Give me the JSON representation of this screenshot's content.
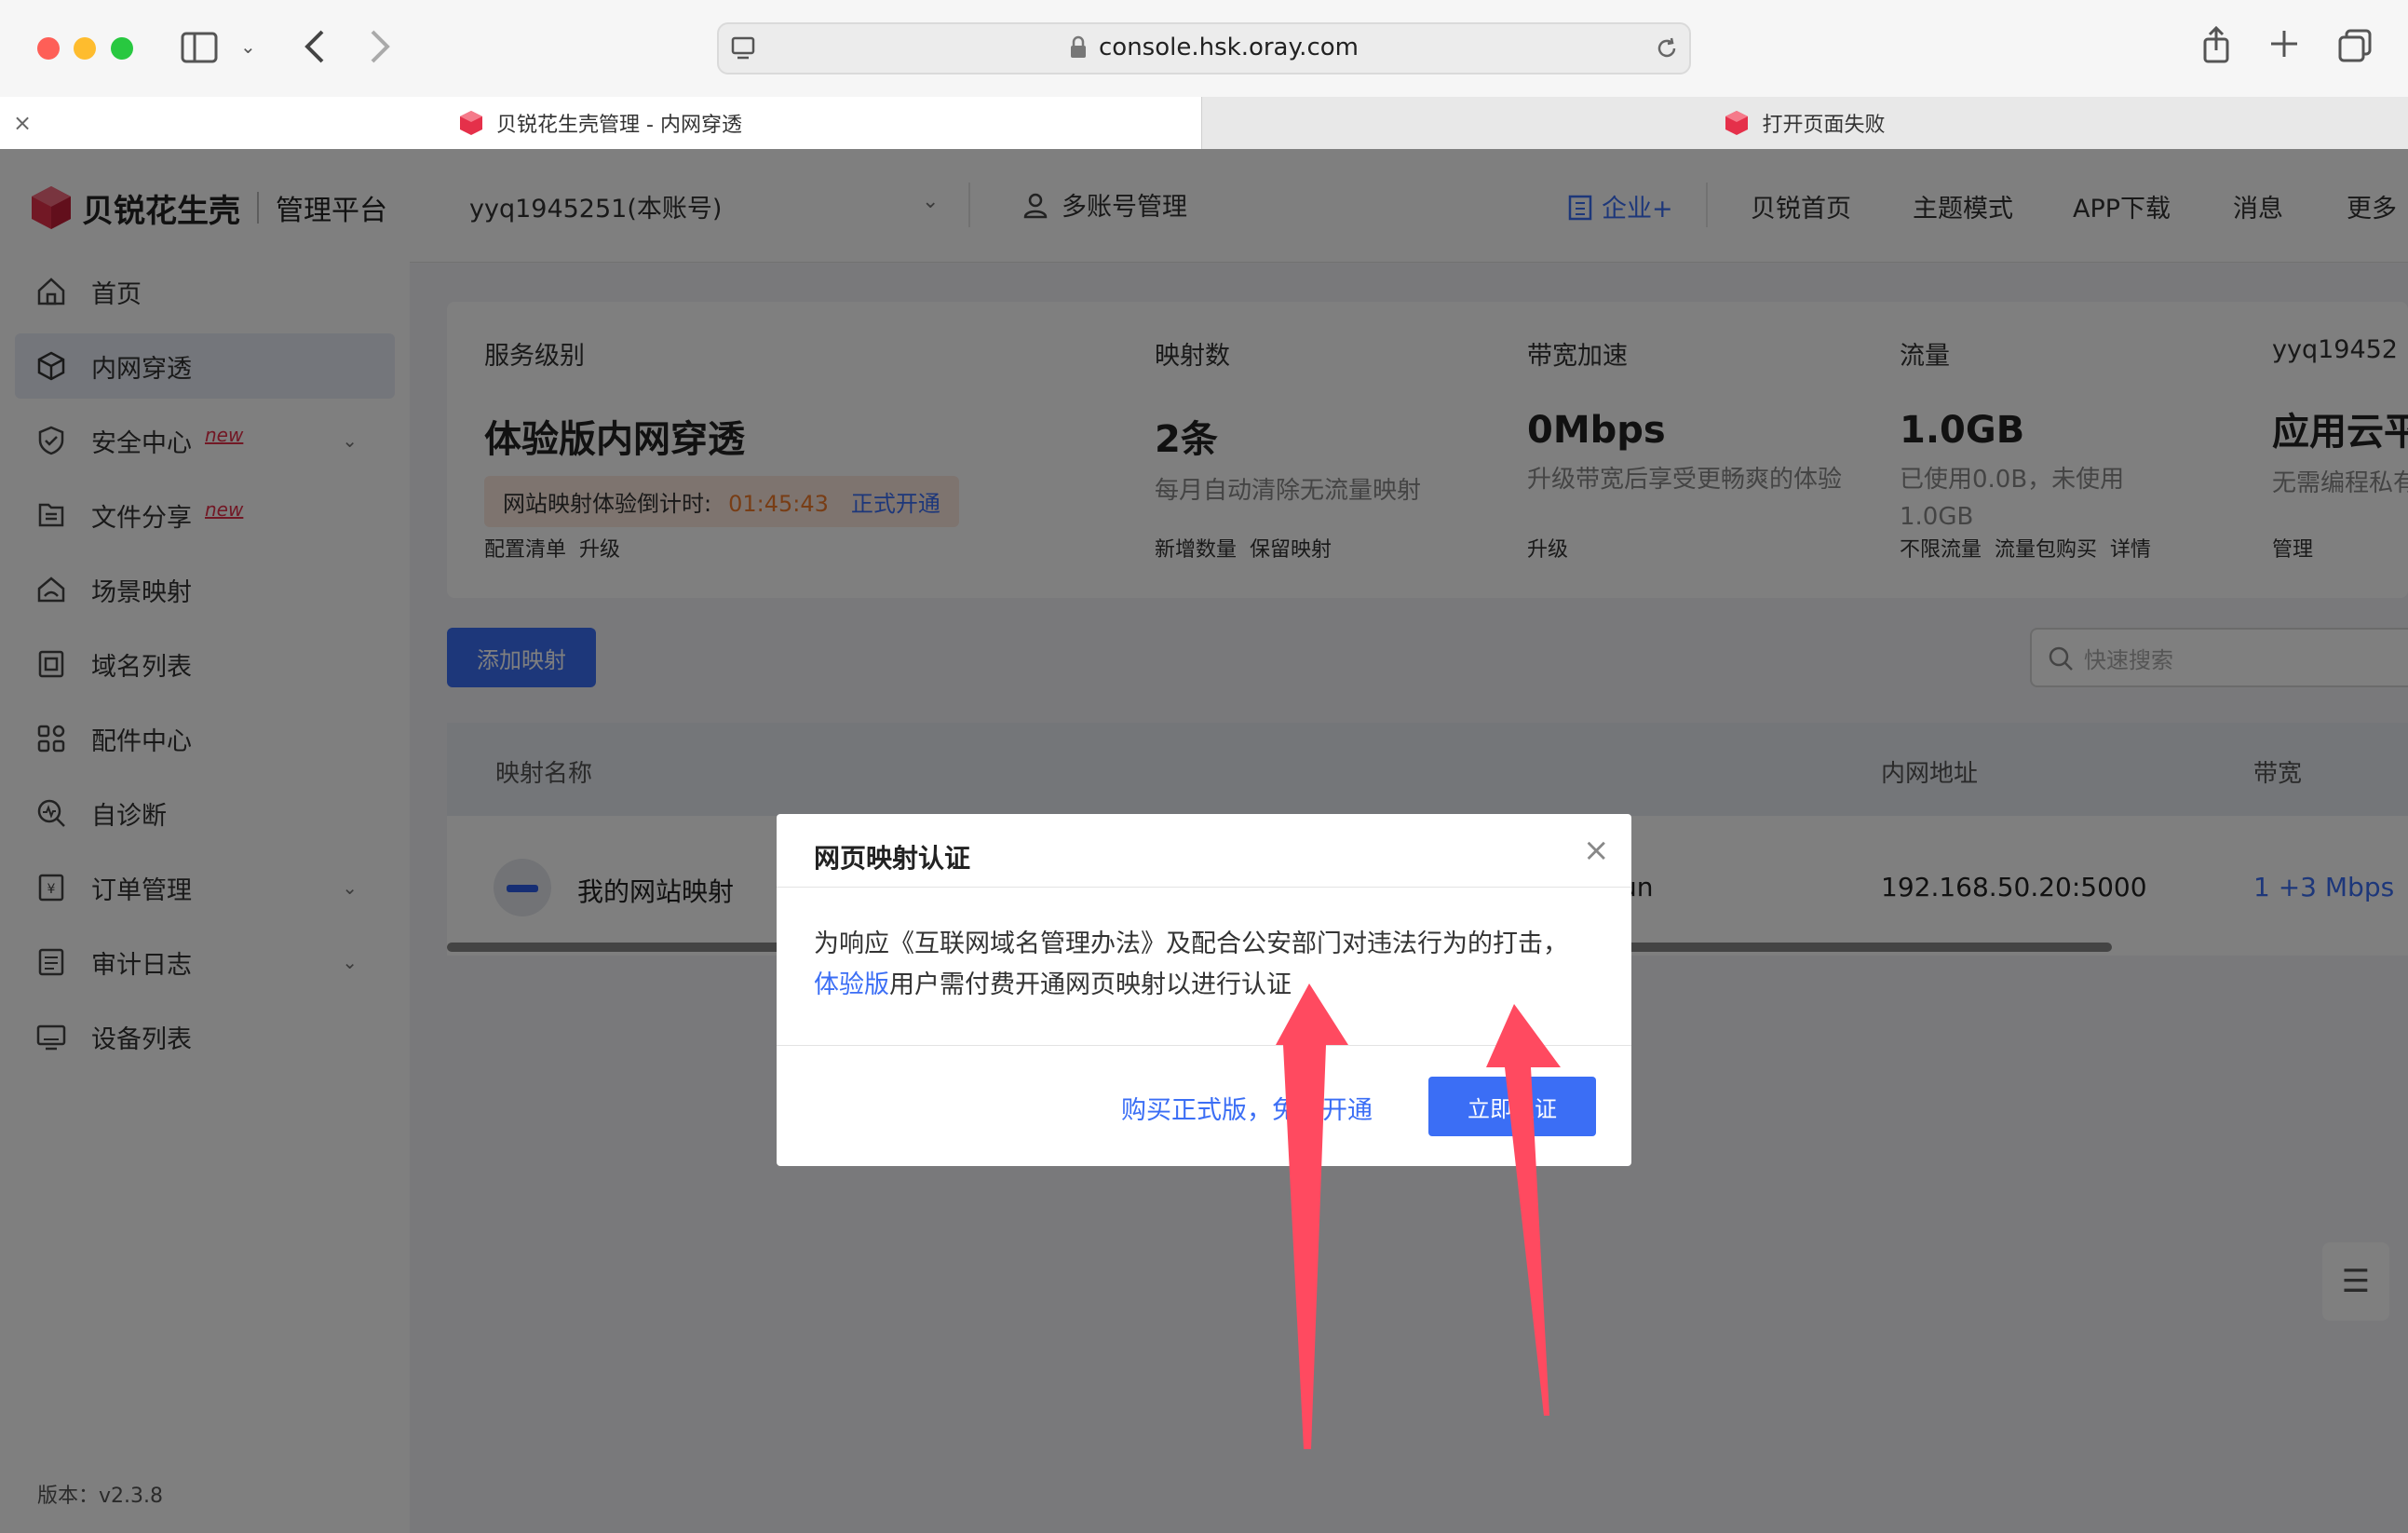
{
  "browser": {
    "url": "console.hsk.oray.com",
    "tabs": [
      {
        "label": "贝锐花生壳管理 - 内网穿透",
        "active": true
      },
      {
        "label": "打开页面失败",
        "active": false
      }
    ]
  },
  "brand": {
    "name": "贝锐花生壳",
    "subtitle": "管理平台",
    "accent": "#3b6ef5",
    "logo_color": "#e5304a"
  },
  "sidebar": {
    "items": [
      {
        "label": "首页",
        "icon": "home-icon"
      },
      {
        "label": "内网穿透",
        "icon": "cube-icon",
        "active": true
      },
      {
        "label": "安全中心",
        "icon": "shield-icon",
        "tag": "new",
        "expandable": true
      },
      {
        "label": "文件分享",
        "icon": "file-share-icon",
        "tag": "new"
      },
      {
        "label": "场景映射",
        "icon": "scene-icon"
      },
      {
        "label": "域名列表",
        "icon": "domain-icon"
      },
      {
        "label": "配件中心",
        "icon": "grid-icon"
      },
      {
        "label": "自诊断",
        "icon": "diagnose-icon"
      },
      {
        "label": "订单管理",
        "icon": "order-icon",
        "expandable": true
      },
      {
        "label": "审计日志",
        "icon": "log-icon",
        "expandable": true
      },
      {
        "label": "设备列表",
        "icon": "device-icon"
      }
    ],
    "version": "版本：v2.3.8"
  },
  "topnav": {
    "account": "yyq1945251(本账号)",
    "multi_account": "多账号管理",
    "enterprise": "企业+",
    "links": [
      "贝锐首页",
      "主题模式",
      "APP下载",
      "消息",
      "更多"
    ]
  },
  "stats": {
    "service": {
      "label": "服务级别",
      "value": "体验版内网穿透",
      "countdown_label": "网站映射体验倒计时:",
      "countdown": "01:45:43",
      "open": "正式开通",
      "links": [
        "配置清单",
        "升级"
      ]
    },
    "mappings": {
      "label": "映射数",
      "value": "2条",
      "desc": "每月自动清除无流量映射",
      "links": [
        "新增数量",
        "保留映射"
      ]
    },
    "bandwidth": {
      "label": "带宽加速",
      "value": "0Mbps",
      "desc": "升级带宽后享受更畅爽的体验",
      "links": [
        "升级"
      ]
    },
    "traffic": {
      "label": "流量",
      "value": "1.0GB",
      "desc": "已使用0.0B，未使用1.0GB",
      "links": [
        "不限流量",
        "流量包购买",
        "详情"
      ]
    },
    "cloud": {
      "label": "yyq19452",
      "value": "应用云平",
      "desc": "无需编程私有",
      "links": [
        "管理"
      ]
    }
  },
  "toolbar": {
    "add_label": "添加映射",
    "search_placeholder": "快速搜索"
  },
  "table": {
    "columns": [
      "映射名称",
      "内网地址",
      "带宽"
    ],
    "rows": [
      {
        "name": "我的网站映射",
        "partial": "un",
        "address": "192.168.50.20:5000",
        "bandwidth": "1 +3 Mbps"
      }
    ]
  },
  "modal": {
    "title": "网页映射认证",
    "body_prefix": "为响应《互联网域名管理办法》及配合公安部门对违法行为的打击，",
    "body_highlight": "体验版",
    "body_suffix": "用户需付费开通网页映射以进行认证",
    "buy_label": "购买正式版，免费开通",
    "confirm_label": "立即认证"
  },
  "annotation_color": "#ff4a60"
}
